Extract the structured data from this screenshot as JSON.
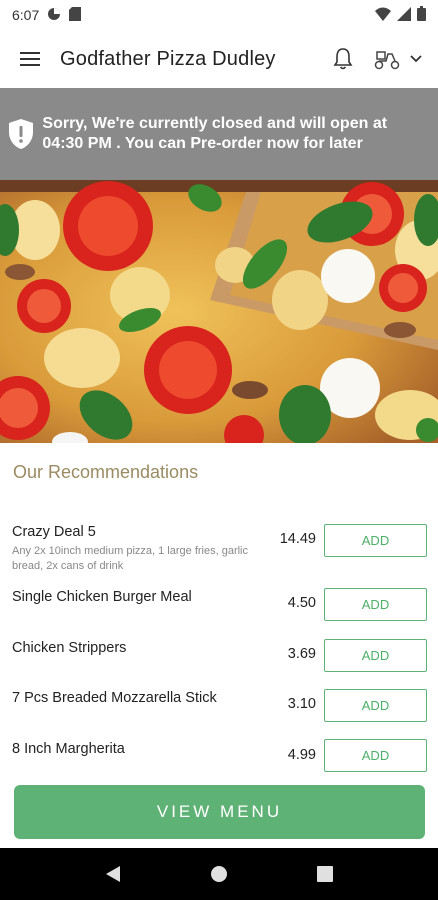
{
  "statusbar": {
    "time": "6:07"
  },
  "header": {
    "title": "Godfather Pizza Dudley"
  },
  "banner": {
    "message": "Sorry, We're currently closed and will open at 04:30 PM . You can Pre-order now for later"
  },
  "recommendations": {
    "title": "Our Recommendations",
    "items": [
      {
        "name": "Crazy Deal 5",
        "description": "Any 2x 10inch medium pizza, 1 large fries, garlic bread, 2x cans of drink",
        "price": "14.49",
        "action": "ADD"
      },
      {
        "name": "Single Chicken Burger Meal",
        "description": "",
        "price": "4.50",
        "action": "ADD"
      },
      {
        "name": "Chicken Strippers",
        "description": "",
        "price": "3.69",
        "action": "ADD"
      },
      {
        "name": "7 Pcs Breaded Mozzarella Stick",
        "description": "",
        "price": "3.10",
        "action": "ADD"
      },
      {
        "name": "8 Inch Margherita",
        "description": "",
        "price": "4.99",
        "action": "ADD"
      }
    ]
  },
  "footer": {
    "view_menu_label": "VIEW MENU"
  },
  "icons": [
    "menu-icon",
    "bell-icon",
    "delivery-scooter-icon",
    "chevron-down-icon",
    "shield-alert-icon",
    "back-icon",
    "home-icon",
    "recents-icon"
  ],
  "colors": {
    "accent": "#5fb276",
    "banner": "#8a8a8a",
    "section_title": "#9b8b62"
  }
}
